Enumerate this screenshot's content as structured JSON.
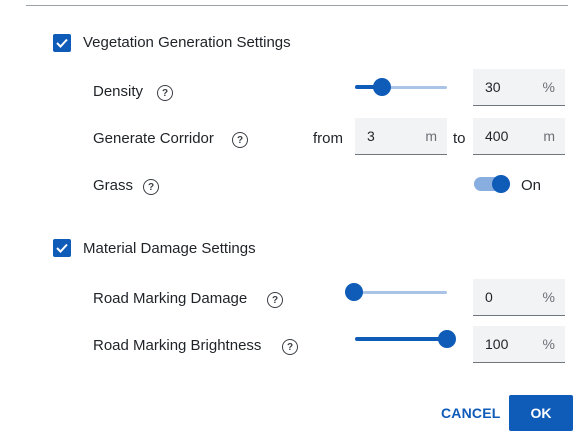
{
  "vegetation": {
    "title": "Vegetation Generation Settings",
    "checked": true,
    "density": {
      "label": "Density",
      "value": "30",
      "unit": "%",
      "slider_fraction": 0.3
    },
    "corridor": {
      "label": "Generate Corridor",
      "from_label": "from",
      "from_value": "3",
      "from_unit": "m",
      "to_label": "to",
      "to_value": "400",
      "to_unit": "m"
    },
    "grass": {
      "label": "Grass",
      "state_label": "On",
      "on": true
    }
  },
  "material": {
    "title": "Material Damage Settings",
    "checked": true,
    "road_marking_damage": {
      "label": "Road Marking Damage",
      "value": "0",
      "unit": "%",
      "slider_fraction": 0.0
    },
    "road_marking_brightness": {
      "label": "Road Marking Brightness",
      "value": "100",
      "unit": "%",
      "slider_fraction": 1.0
    }
  },
  "footer": {
    "cancel_label": "CANCEL",
    "ok_label": "OK"
  },
  "icons": {
    "help": "help-circle-icon",
    "check": "checkmark-icon"
  },
  "colors": {
    "accent": "#0f5bb8",
    "track": "#a9c4e6",
    "field_bg": "#f2f3f5"
  }
}
